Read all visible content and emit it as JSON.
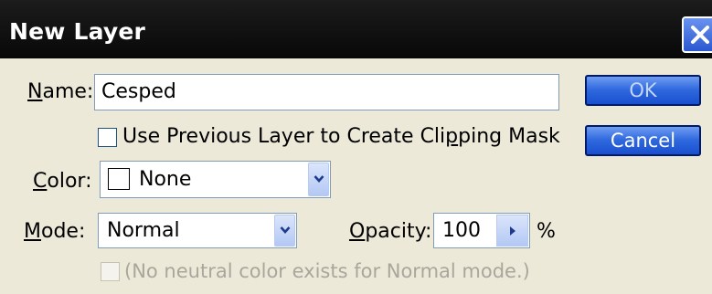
{
  "window": {
    "title": "New Layer"
  },
  "name_field": {
    "label_prefix": "",
    "label_mnemonic": "N",
    "label_rest": "ame:",
    "value": "Cesped"
  },
  "clipping_mask": {
    "label_before": "Use Previous Layer to Create Cli",
    "label_mnemonic": "p",
    "label_after": "ping Mask",
    "checked": false
  },
  "color_field": {
    "label_prefix": "",
    "label_mnemonic": "C",
    "label_rest": "olor:",
    "value": "None",
    "swatch": "#ffffff"
  },
  "mode_field": {
    "label_prefix": "",
    "label_mnemonic": "M",
    "label_rest": "ode:",
    "value": "Normal"
  },
  "opacity_field": {
    "label_prefix": "",
    "label_mnemonic": "O",
    "label_rest": "pacity:",
    "value": "100",
    "unit": "%"
  },
  "neutral_color": {
    "label": "(No neutral color exists for Normal mode.)",
    "checked": false,
    "enabled": false
  },
  "buttons": {
    "ok": "OK",
    "cancel": "Cancel"
  },
  "icons": {
    "close": "close-icon",
    "dropdown": "chevron-down-icon",
    "spinner": "triangle-right-icon"
  },
  "colors": {
    "titlebar": "#0a0a0a",
    "dialog_bg": "#ece9d8",
    "button_blue": "#2f68de"
  }
}
